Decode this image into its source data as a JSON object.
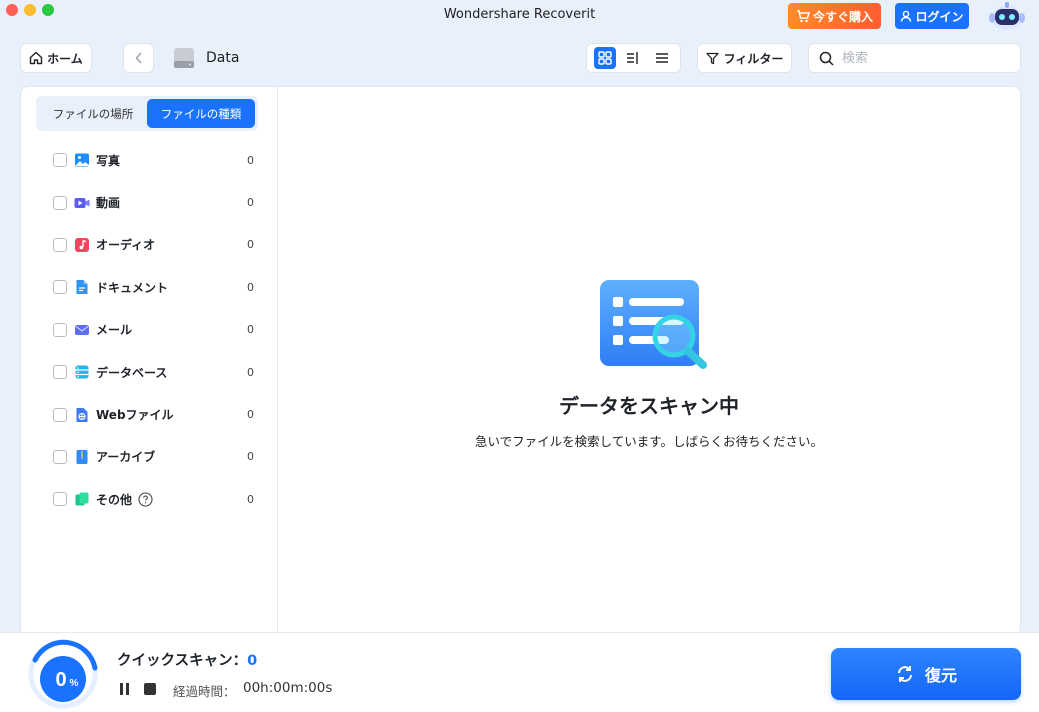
{
  "window": {
    "title": "Wondershare Recoverit",
    "buy_label": "今すぐ購入",
    "login_label": "ログイン"
  },
  "toolbar": {
    "home_label": "ホーム",
    "path": "Data",
    "filter_label": "フィルター",
    "search_placeholder": "検索"
  },
  "sidebar": {
    "tabs": [
      {
        "label": "ファイルの場所",
        "active": false
      },
      {
        "label": "ファイルの種類",
        "active": true
      }
    ],
    "categories": [
      {
        "label": "写真",
        "count": "0",
        "icon": "photo-icon",
        "color": "#1a8cff"
      },
      {
        "label": "動画",
        "count": "0",
        "icon": "video-icon",
        "color": "#5b5bf5"
      },
      {
        "label": "オーディオ",
        "count": "0",
        "icon": "audio-icon",
        "color": "#f5455c"
      },
      {
        "label": "ドキュメント",
        "count": "0",
        "icon": "document-icon",
        "color": "#2b95f5"
      },
      {
        "label": "メール",
        "count": "0",
        "icon": "mail-icon",
        "color": "#5d6cf0"
      },
      {
        "label": "データベース",
        "count": "0",
        "icon": "database-icon",
        "color": "#1fb8e6"
      },
      {
        "label": "Webファイル",
        "count": "0",
        "icon": "web-file-icon",
        "color": "#3d7bf5"
      },
      {
        "label": "アーカイブ",
        "count": "0",
        "icon": "archive-icon",
        "color": "#2f8cf7"
      },
      {
        "label": "その他",
        "count": "0",
        "icon": "other-icon",
        "color": "#20c48a"
      }
    ]
  },
  "main": {
    "scan_title": "データをスキャン中",
    "scan_subtitle": "急いでファイルを検索しています。しばらくお待ちください。"
  },
  "status": {
    "progress_percent": 0,
    "progress_number": "0",
    "progress_unit": "%",
    "scan_label": "クイックスキャン：",
    "scan_count": "0",
    "elapsed_label": "経過時間：",
    "elapsed_value": "00h:00m:00s",
    "restore_label": "復元"
  },
  "colors": {
    "accent": "#1a73ff",
    "buy": "#ff6a2d"
  }
}
